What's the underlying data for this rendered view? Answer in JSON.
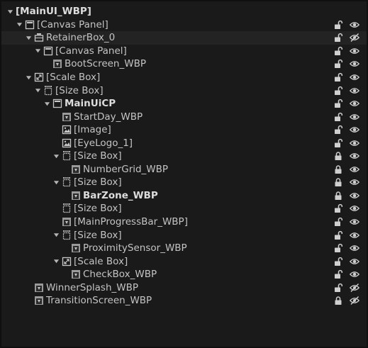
{
  "colors": {
    "background": "#1a1a1a",
    "row_alt": "#232323",
    "text": "#c4c4c4",
    "icon": "#bdbdbd"
  },
  "tree": [
    {
      "label": "[MainUI_WBP]",
      "depth": 0,
      "arrow": true,
      "icon": "none",
      "bold": true,
      "lock": "none",
      "visibility": "none"
    },
    {
      "label": "[Canvas Panel]",
      "depth": 1,
      "arrow": true,
      "icon": "canvas-panel-icon",
      "bold": false,
      "lock": "unlocked",
      "visibility": "visible"
    },
    {
      "label": "RetainerBox_0",
      "depth": 2,
      "arrow": true,
      "icon": "retainer-box-icon",
      "bold": false,
      "lock": "unlocked",
      "visibility": "hidden"
    },
    {
      "label": "[Canvas Panel]",
      "depth": 3,
      "arrow": true,
      "icon": "canvas-panel-icon",
      "bold": false,
      "lock": "unlocked",
      "visibility": "visible"
    },
    {
      "label": "BootScreen_WBP",
      "depth": 4,
      "arrow": false,
      "icon": "widget-blueprint-icon",
      "bold": false,
      "lock": "unlocked",
      "visibility": "visible"
    },
    {
      "label": "[Scale Box]",
      "depth": 2,
      "arrow": true,
      "icon": "scale-box-icon",
      "bold": false,
      "lock": "unlocked",
      "visibility": "visible"
    },
    {
      "label": "[Size Box]",
      "depth": 3,
      "arrow": true,
      "icon": "size-box-icon",
      "bold": false,
      "lock": "unlocked",
      "visibility": "visible"
    },
    {
      "label": "MainUiCP",
      "depth": 4,
      "arrow": true,
      "icon": "canvas-panel-icon",
      "bold": true,
      "lock": "unlocked",
      "visibility": "visible"
    },
    {
      "label": "StartDay_WBP",
      "depth": 5,
      "arrow": false,
      "icon": "widget-blueprint-icon",
      "bold": false,
      "lock": "unlocked",
      "visibility": "visible"
    },
    {
      "label": "[Image]",
      "depth": 5,
      "arrow": false,
      "icon": "image-icon",
      "bold": false,
      "lock": "unlocked",
      "visibility": "visible"
    },
    {
      "label": "[EyeLogo_1]",
      "depth": 5,
      "arrow": false,
      "icon": "image-icon",
      "bold": false,
      "lock": "unlocked",
      "visibility": "visible"
    },
    {
      "label": "[Size Box]",
      "depth": 5,
      "arrow": true,
      "icon": "size-box-icon",
      "bold": false,
      "lock": "locked",
      "visibility": "visible"
    },
    {
      "label": "NumberGrid_WBP",
      "depth": 6,
      "arrow": false,
      "icon": "widget-blueprint-icon",
      "bold": false,
      "lock": "locked",
      "visibility": "visible"
    },
    {
      "label": "[Size Box]",
      "depth": 5,
      "arrow": true,
      "icon": "size-box-icon",
      "bold": false,
      "lock": "locked",
      "visibility": "visible"
    },
    {
      "label": "BarZone_WBP",
      "depth": 6,
      "arrow": false,
      "icon": "widget-blueprint-icon",
      "bold": true,
      "lock": "locked",
      "visibility": "visible"
    },
    {
      "label": "[Size Box]",
      "depth": 5,
      "arrow": false,
      "icon": "size-box-icon",
      "bold": false,
      "lock": "unlocked",
      "visibility": "visible"
    },
    {
      "label": "[MainProgressBar_WBP]",
      "depth": 5,
      "arrow": false,
      "icon": "widget-blueprint-icon",
      "bold": false,
      "lock": "unlocked",
      "visibility": "visible"
    },
    {
      "label": "[Size Box]",
      "depth": 5,
      "arrow": true,
      "icon": "size-box-icon",
      "bold": false,
      "lock": "unlocked",
      "visibility": "visible"
    },
    {
      "label": "ProximitySensor_WBP",
      "depth": 6,
      "arrow": false,
      "icon": "widget-blueprint-icon",
      "bold": false,
      "lock": "unlocked",
      "visibility": "visible"
    },
    {
      "label": "[Scale Box]",
      "depth": 5,
      "arrow": true,
      "icon": "scale-box-icon",
      "bold": false,
      "lock": "unlocked",
      "visibility": "visible"
    },
    {
      "label": "CheckBox_WBP",
      "depth": 6,
      "arrow": false,
      "icon": "widget-blueprint-icon",
      "bold": false,
      "lock": "unlocked",
      "visibility": "visible"
    },
    {
      "label": "WinnerSplash_WBP",
      "depth": 2,
      "arrow": false,
      "icon": "widget-blueprint-icon",
      "bold": false,
      "lock": "unlocked",
      "visibility": "hidden"
    },
    {
      "label": "TransitionScreen_WBP",
      "depth": 2,
      "arrow": false,
      "icon": "widget-blueprint-icon",
      "bold": false,
      "lock": "locked",
      "visibility": "hidden"
    }
  ]
}
